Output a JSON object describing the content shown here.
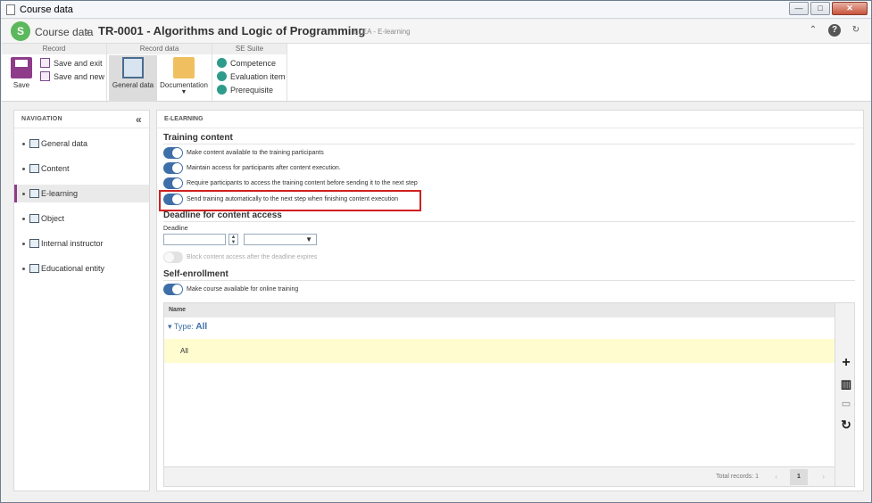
{
  "window": {
    "title": "Course data"
  },
  "header": {
    "logo_letter": "S",
    "breadcrumb_parent": "Course data",
    "separator": "›",
    "breadcrumb_title": "TR-0001 - Algorithms and Logic of Programming",
    "breadcrumb_sub": "ELEA - E-learning"
  },
  "ribbon": {
    "record_group": "Record",
    "record_data_group": "Record data",
    "se_suite_group": "SE Suite",
    "save": "Save",
    "save_and_exit": "Save and exit",
    "save_and_new": "Save and new",
    "general_data": "General data",
    "documentation": "Documentation",
    "competence": "Competence",
    "evaluation_item": "Evaluation item",
    "prerequisite": "Prerequisite"
  },
  "nav": {
    "title": "NAVIGATION",
    "items": [
      {
        "label": "General data",
        "icon": "form-icon"
      },
      {
        "label": "Content",
        "icon": "content-icon"
      },
      {
        "label": "E-learning",
        "icon": "elearning-icon"
      },
      {
        "label": "Object",
        "icon": "object-icon"
      },
      {
        "label": "Internal instructor",
        "icon": "instructor-icon"
      },
      {
        "label": "Educational entity",
        "icon": "building-icon"
      }
    ]
  },
  "main": {
    "title": "E-LEARNING",
    "training_content": "Training content",
    "toggle1": "Make content available to the training participants",
    "toggle2": "Maintain access for participants after content execution.",
    "toggle3": "Require participants to access the training content before sending it to the next step",
    "toggle4": "Send training automatically to the next step when finishing content execution",
    "deadline_section": "Deadline for content access",
    "deadline_label": "Deadline",
    "deadline_value": "",
    "deadline_unit": "",
    "block_toggle": "Block content access after the deadline expires",
    "self_enrollment": "Self-enrollment",
    "self_toggle": "Make course available for online training",
    "grid": {
      "column_name": "Name",
      "group_prefix": "Type:",
      "group_value": "All",
      "row_value": "All",
      "total_records": "Total records: 1",
      "page": "1"
    }
  },
  "colors": {
    "accent": "#3e6fa8",
    "highlight": "#d02020",
    "brand": "#8e3c8a"
  }
}
